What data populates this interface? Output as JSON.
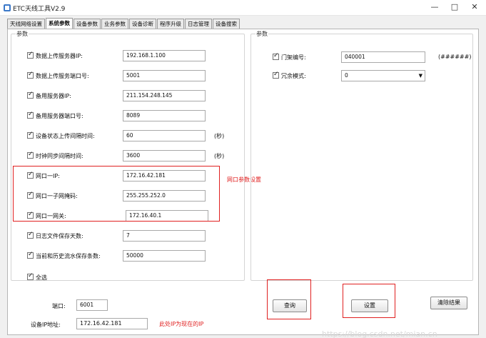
{
  "window": {
    "title": "ETC天线工具V2.9",
    "minimize": "—",
    "maximize": "□",
    "close": "✕"
  },
  "tabs": [
    {
      "label": "天线网络设置"
    },
    {
      "label": "系统参数"
    },
    {
      "label": "设备参数"
    },
    {
      "label": "业务参数"
    },
    {
      "label": "设备诊断"
    },
    {
      "label": "程序升级"
    },
    {
      "label": "日志管理"
    },
    {
      "label": "设备搜索"
    }
  ],
  "left_group": {
    "title": "参数",
    "fields": [
      {
        "label": "数据上传服务器IP:",
        "value": "192.168.1.100"
      },
      {
        "label": "数据上传服务端口号:",
        "value": "5001"
      },
      {
        "label": "备用服务器IP:",
        "value": "211.154.248.145"
      },
      {
        "label": "备用服务器端口号:",
        "value": "8089"
      },
      {
        "label": "设备状态上传间隔时间:",
        "value": "60",
        "unit": "(秒)"
      },
      {
        "label": "时钟同步间隔时间:",
        "value": "3600",
        "unit": "(秒)"
      },
      {
        "label": "网口一IP:",
        "value": "172.16.42.181"
      },
      {
        "label": "网口一子网掩码:",
        "value": "255.255.252.0"
      },
      {
        "label": "网口一网关:",
        "value": "172.16.40.1"
      },
      {
        "label": "日志文件保存天数:",
        "value": "7"
      },
      {
        "label": "当前和历史流水保存条数:",
        "value": "50000"
      }
    ],
    "select_all": "全选"
  },
  "annotations": {
    "network_note": "网口参数设置",
    "ip_note": "此处IP为现在的IP"
  },
  "right_group": {
    "title": "参数",
    "gantry": {
      "label": "门架编号:",
      "value": "040001",
      "hint": "(######)"
    },
    "redundant": {
      "label": "冗余模式:",
      "value": "0"
    }
  },
  "bottom": {
    "port_label": "端口:",
    "port_value": "6001",
    "ip_label": "设备IP地址:",
    "ip_value": "172.16.42.181"
  },
  "buttons": {
    "query": "查询",
    "set": "设置",
    "clear": "清除结果"
  },
  "watermark": "https://blog.csdn.net/mian.cn"
}
